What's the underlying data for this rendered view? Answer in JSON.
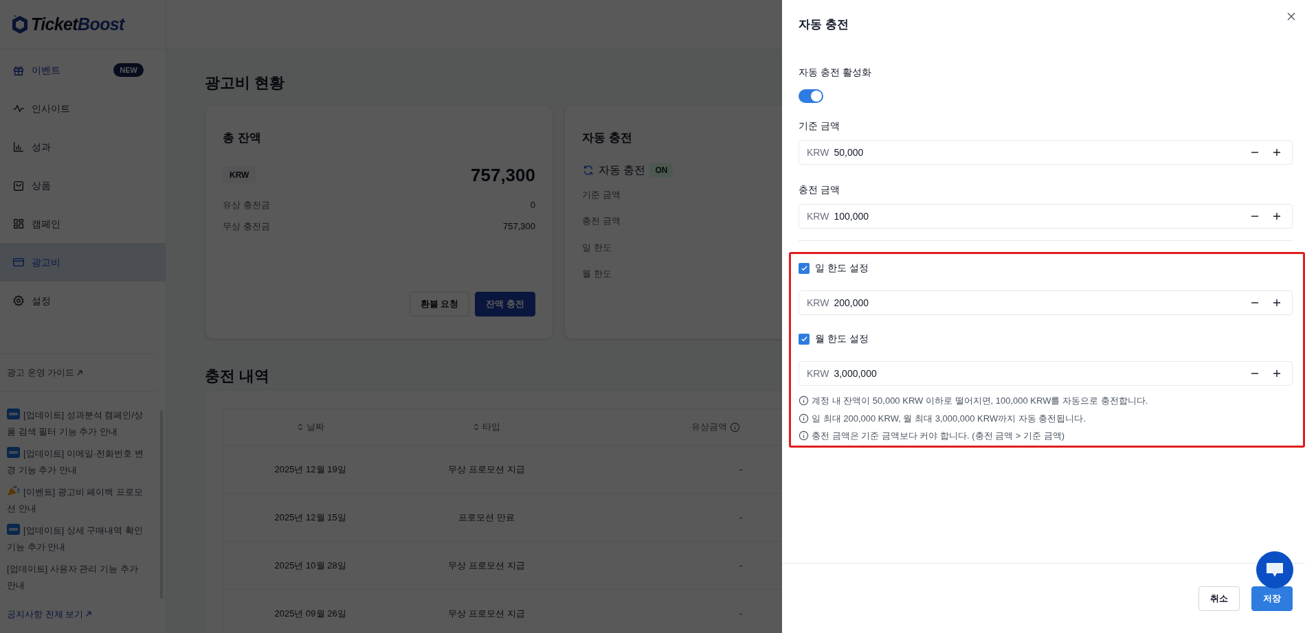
{
  "sidebar": {
    "logo": {
      "part_1": "Ticket",
      "part_2": "Boost"
    },
    "nav": [
      {
        "label": "이벤트",
        "selected": false,
        "badge": "NEW"
      },
      {
        "label": "인사이트",
        "selected": false
      },
      {
        "label": "성과",
        "selected": false
      },
      {
        "label": "상품",
        "selected": false
      },
      {
        "label": "캠페인",
        "selected": false
      },
      {
        "label": "광고비",
        "selected": true
      },
      {
        "label": "설정",
        "selected": false
      }
    ],
    "guide_link": "광고 운영 가이드",
    "notices": [
      {
        "kind": "new",
        "text": "[업데이트] 성과분석 캠페인/상품 검색 필터 기능 추가 안내"
      },
      {
        "kind": "new",
        "text": "[업데이트] 이메일·전화번호 변경 기능 추가 안내"
      },
      {
        "kind": "event",
        "text": "[이벤트] 광고비 페이백 프로모션 안내"
      },
      {
        "kind": "new",
        "text": "[업데이트] 상세 구매내역 확인 기능 추가 안내"
      },
      {
        "kind": "plain",
        "text": "[업데이트] 사용자 관리 기능 추가 안내"
      }
    ],
    "all_notices_link": "공지사항 전체 보기"
  },
  "main": {
    "title": "광고비 현황",
    "balance_card": {
      "title": "총 잔액",
      "currency": "KRW",
      "total": "757,300",
      "rows": [
        {
          "label": "유상 충전금",
          "value": "0"
        },
        {
          "label": "무상 충전금",
          "value": "757,300"
        }
      ],
      "buttons": [
        {
          "label": "환불 요청",
          "kind": "secondary"
        },
        {
          "label": "잔액 충전",
          "kind": "primary"
        }
      ]
    },
    "auto_card": {
      "title": "자동 충전",
      "status_label": "자동 충전",
      "status_badge": "ON",
      "rows": [
        "기준 금액",
        "충전 금액",
        "일 한도",
        "월 한도"
      ]
    },
    "history": {
      "title": "충전 내역",
      "columns": [
        {
          "label": "날짜",
          "sortable": true,
          "info": false
        },
        {
          "label": "타입",
          "sortable": true,
          "info": false
        },
        {
          "label": "유상금액",
          "sortable": false,
          "info": true
        }
      ],
      "rows": [
        [
          "2025년 12월 19일",
          "무상 프로모션 지급",
          "-"
        ],
        [
          "2025년 12월 15일",
          "프로모션 만료",
          "-"
        ],
        [
          "2025년 10월 28일",
          "무상 프로모션 지급",
          "-"
        ],
        [
          "2025년 09월 26일",
          "무상 프로모션 지급",
          "-"
        ]
      ]
    }
  },
  "drawer": {
    "title": "자동 충전",
    "enable_label": "자동 충전 활성화",
    "enabled": true,
    "fields": [
      {
        "label": "기준 금액",
        "currency": "KRW",
        "value": "50,000"
      },
      {
        "label": "충전 금액",
        "currency": "KRW",
        "value": "100,000"
      }
    ],
    "limits": [
      {
        "label": "일 한도 설정",
        "checked": true,
        "currency": "KRW",
        "value": "200,000"
      },
      {
        "label": "월 한도 설정",
        "checked": true,
        "currency": "KRW",
        "value": "3,000,000"
      }
    ],
    "notes": [
      "계정 내 잔액이 50,000 KRW 이하로 떨어지면, 100,000 KRW를 자동으로 충전합니다.",
      "일 최대 200,000 KRW, 월 최대 3,000,000 KRW까지 자동 충전됩니다.",
      "충전 금액은 기준 금액보다 커야 합니다. (충전 금액 > 기준 금액)"
    ],
    "buttons": [
      {
        "label": "취소",
        "kind": "secondary"
      },
      {
        "label": "저장",
        "kind": "primary"
      }
    ]
  }
}
